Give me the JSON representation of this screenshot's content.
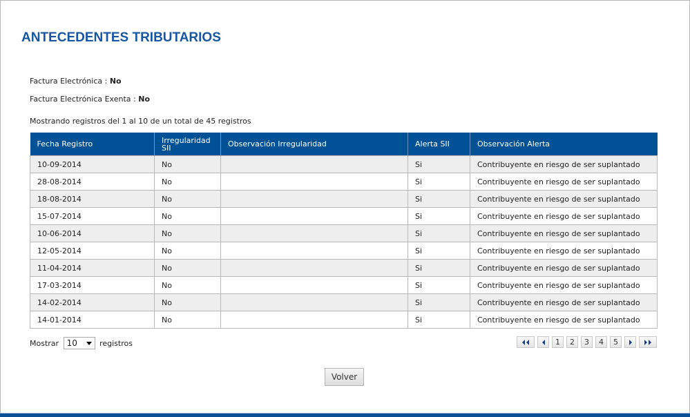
{
  "page": {
    "title": "ANTECEDENTES TRIBUTARIOS",
    "factura_label": "Factura Electrónica : ",
    "factura_value": "No",
    "factura_exenta_label": "Factura Electrónica Exenta : ",
    "factura_exenta_value": "No",
    "records_info": "Mostrando registros del 1 al 10 de un total de 45 registros"
  },
  "table": {
    "headers": [
      "Fecha Registro",
      "Irregularidad SII",
      "Observación Irregularidad",
      "Alerta SII",
      "Observación Alerta"
    ],
    "rows": [
      [
        "10-09-2014",
        "No",
        "",
        "Si",
        "Contribuyente en riesgo de ser suplantado"
      ],
      [
        "28-08-2014",
        "No",
        "",
        "Si",
        "Contribuyente en riesgo de ser suplantado"
      ],
      [
        "18-08-2014",
        "No",
        "",
        "Si",
        "Contribuyente en riesgo de ser suplantado"
      ],
      [
        "15-07-2014",
        "No",
        "",
        "Si",
        "Contribuyente en riesgo de ser suplantado"
      ],
      [
        "10-06-2014",
        "No",
        "",
        "Si",
        "Contribuyente en riesgo de ser suplantado"
      ],
      [
        "12-05-2014",
        "No",
        "",
        "Si",
        "Contribuyente en riesgo de ser suplantado"
      ],
      [
        "11-04-2014",
        "No",
        "",
        "Si",
        "Contribuyente en riesgo de ser suplantado"
      ],
      [
        "17-03-2014",
        "No",
        "",
        "Si",
        "Contribuyente en riesgo de ser suplantado"
      ],
      [
        "14-02-2014",
        "No",
        "",
        "Si",
        "Contribuyente en riesgo de ser suplantado"
      ],
      [
        "14-01-2014",
        "No",
        "",
        "Si",
        "Contribuyente en riesgo de ser suplantado"
      ]
    ]
  },
  "length": {
    "prefix": "Mostrar",
    "value": "10",
    "suffix": "registros"
  },
  "pagination": {
    "pages": [
      "1",
      "2",
      "3",
      "4",
      "5"
    ],
    "icons": [
      "first-page-icon",
      "previous-page-icon",
      "next-page-icon",
      "last-page-icon"
    ]
  },
  "volver_label": "Volver",
  "colors": {
    "title": "#1656a4",
    "header_bg": "#005195",
    "stripe": "#eeeeee",
    "bottom_bar": "#0b4f95"
  }
}
